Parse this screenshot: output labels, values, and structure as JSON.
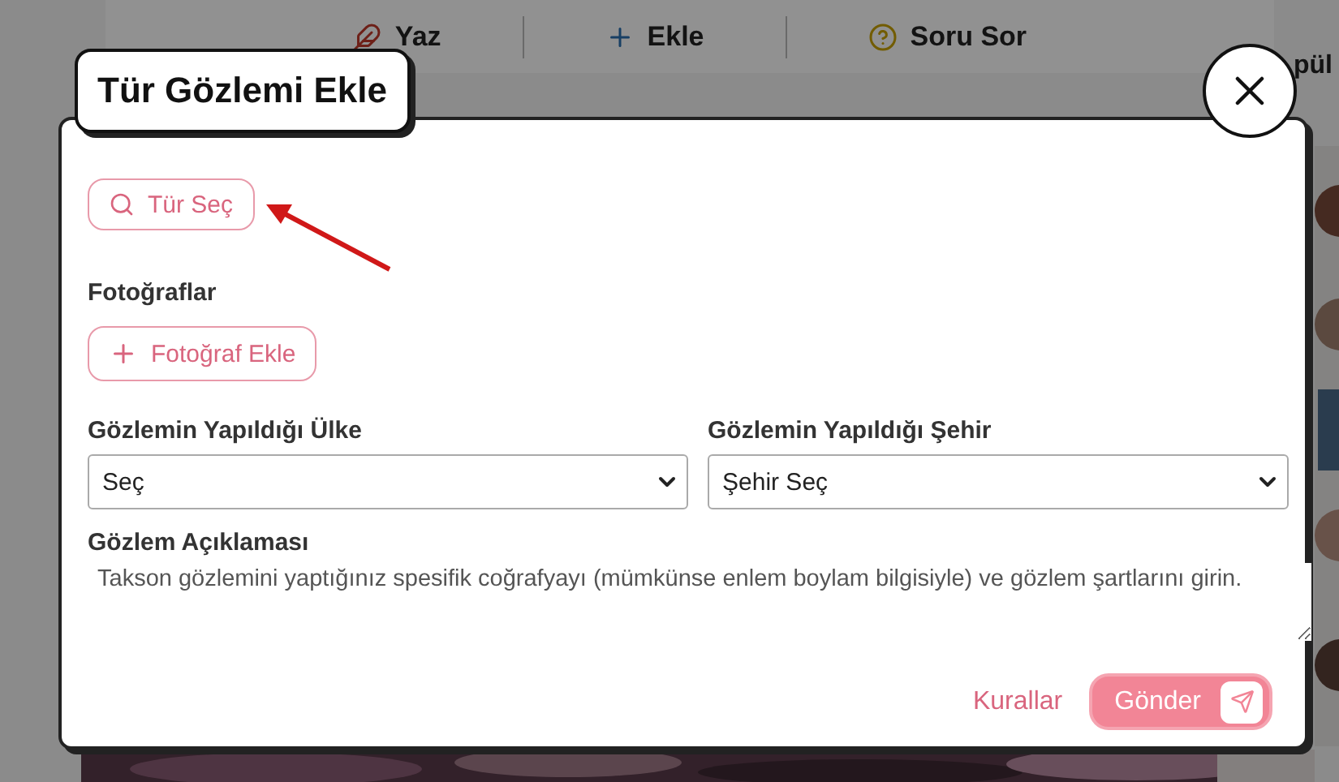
{
  "page": {
    "toolbar": [
      {
        "kind": "write",
        "label": "Yaz"
      },
      {
        "kind": "add",
        "label": "Ekle"
      },
      {
        "kind": "question",
        "label": "Soru Sor"
      }
    ],
    "side_heading": "pül"
  },
  "dialog": {
    "title": "Tür Gözlemi Ekle",
    "species_button": "Tür Seç",
    "photos": {
      "label": "Fotoğraflar",
      "button": "Fotoğraf Ekle"
    },
    "country": {
      "label": "Gözlemin Yapıldığı Ülke",
      "value": "Seç"
    },
    "city": {
      "label": "Gözlemin Yapıldığı Şehir",
      "value": "Şehir Seç"
    },
    "description": {
      "label": "Gözlem Açıklaması",
      "placeholder": "Takson gözlemini yaptığınız spesifik coğrafyayı (mümkünse enlem boylam bilgisiyle) ve gözlem şartlarını girin."
    },
    "rules_link": "Kurallar",
    "submit_button": "Gönder"
  }
}
